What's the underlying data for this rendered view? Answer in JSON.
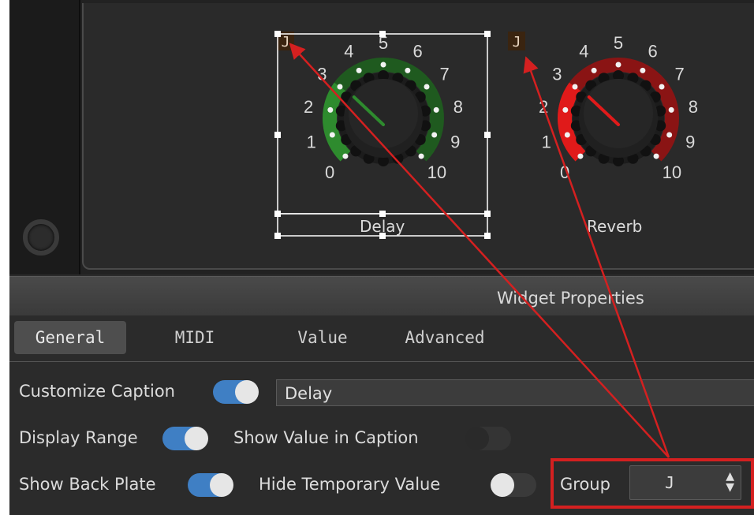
{
  "knobs": [
    {
      "caption": "Delay",
      "group_badge": "J",
      "scale_labels": [
        "0",
        "1",
        "2",
        "3",
        "4",
        "5",
        "6",
        "7",
        "8",
        "9",
        "10"
      ],
      "value_fraction": 0.3,
      "accent_color": "#2e8b2e",
      "accent_dark": "#1f5a1f",
      "selected": true
    },
    {
      "caption": "Reverb",
      "group_badge": "J",
      "scale_labels": [
        "0",
        "1",
        "2",
        "3",
        "4",
        "5",
        "6",
        "7",
        "8",
        "9",
        "10"
      ],
      "value_fraction": 0.3,
      "accent_color": "#e01a1a",
      "accent_dark": "#8a1414",
      "selected": false
    }
  ],
  "properties": {
    "title": "Widget Properties",
    "tabs": [
      {
        "label": "General",
        "active": true
      },
      {
        "label": "MIDI",
        "active": false
      },
      {
        "label": "Value",
        "active": false
      },
      {
        "label": "Advanced",
        "active": false
      }
    ],
    "customize_caption": {
      "label": "Customize Caption",
      "on": true,
      "value": "Delay"
    },
    "display_range": {
      "label": "Display Range",
      "on": true
    },
    "show_value_in_caption": {
      "label": "Show Value in Caption",
      "on": false
    },
    "show_back_plate": {
      "label": "Show Back Plate",
      "on": true
    },
    "hide_temporary_value": {
      "label": "Hide Temporary Value",
      "on": false
    },
    "group": {
      "label": "Group",
      "value": "J"
    }
  },
  "colors": {
    "toggle_on": "#3f7fc4",
    "annotation_red": "#d42020"
  }
}
